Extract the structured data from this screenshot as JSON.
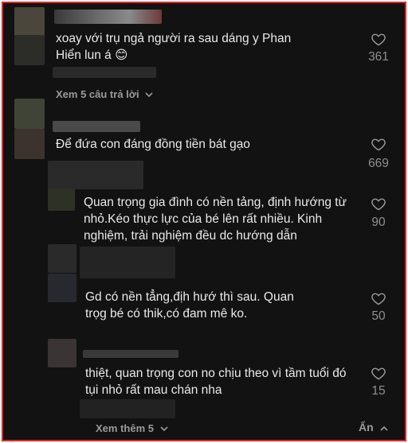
{
  "comments": [
    {
      "text": "xoay với trụ ngả người ra sau dáng y Phan Hiển lun á",
      "emoji": "😊",
      "likes": "361"
    },
    {
      "text": "Để đứa con đáng đồng tiền bát gạo",
      "likes": "669"
    }
  ],
  "replies": [
    {
      "text": "Quan trọng gia đình có nền tảng, định hướng từ nhỏ.Kéo thực lực của bé lên rất nhiều. Kinh nghiệm, trải nghiệm đều dc hướng dẫn",
      "likes": "90"
    },
    {
      "text": "Gd có nền tẳng,địh hướ thì sau. Quan trọg bé có thik,có đam mê ko.",
      "likes": "50"
    },
    {
      "text": "thiệt, quan trọng con no chịu theo vì tầm tuổi đó tụi nhỏ rất mau chán nha",
      "likes": "15"
    }
  ],
  "view_replies_label": "Xem 5 câu trả lời",
  "view_more_label": "Xem thêm 5",
  "hide_label": "Ẩn",
  "colors": {
    "background": "#121212",
    "text": "#e9e9e9",
    "muted": "#8f8f8f",
    "border": "#e3262b"
  }
}
